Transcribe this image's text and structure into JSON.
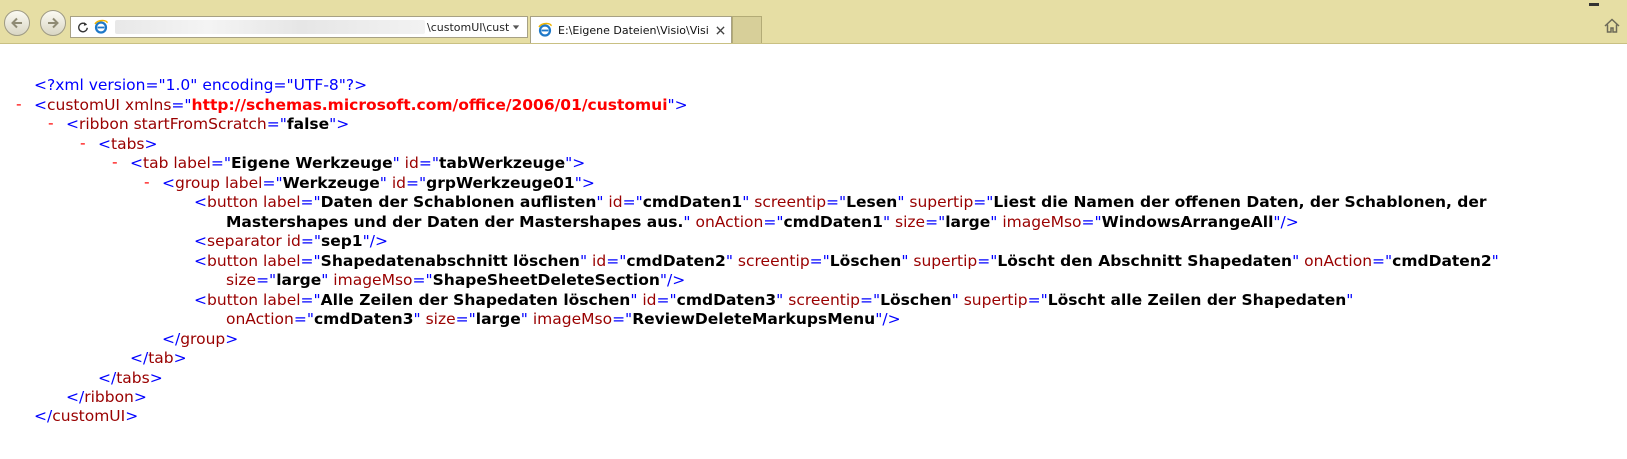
{
  "browser": {
    "address_text": "\\customUI\\custo",
    "tab_title": "E:\\Eigene Dateien\\Visio\\Visi...",
    "icons": {
      "back": "back-arrow-icon",
      "forward": "forward-arrow-icon",
      "refresh": "refresh-icon",
      "site": "ie-page-icon",
      "dropdown": "chevron-down-icon",
      "close": "close-icon",
      "home": "home-icon"
    }
  },
  "colors": {
    "chrome": "#e6dea4",
    "punctuation": "#0000ff",
    "tag": "#990000",
    "value": "#000000",
    "namespace": "#ff0000",
    "toggle": "#ff0000"
  },
  "xml": {
    "l01": {
      "open": "<?xml version=\"1.0\" encoding=\"UTF-8\"?>"
    },
    "l02": {
      "minus": "-",
      "open": "<",
      "name": "customUI",
      "a1": " xmlns",
      "eq1": "=\"",
      "ns": "http://schemas.microsoft.com/office/2006/01/customui",
      "close": "\">"
    },
    "l03": {
      "minus": "-",
      "open": "<",
      "name": "ribbon",
      "a1": " startFromScratch",
      "eq1": "=\"",
      "v1": "false",
      "close": "\">"
    },
    "l04": {
      "minus": "-",
      "open": "<",
      "name": "tabs",
      "close": ">"
    },
    "l05": {
      "minus": "-",
      "open": "<",
      "name": "tab",
      "a1": " label",
      "eq1": "=\"",
      "v1": "Eigene Werkzeuge",
      "q1": "\"",
      "a2": " id",
      "eq2": "=\"",
      "v2": "tabWerkzeuge",
      "close": "\">"
    },
    "l06": {
      "minus": "-",
      "open": "<",
      "name": "group",
      "a1": " label",
      "eq1": "=\"",
      "v1": "Werkzeuge",
      "q1": "\"",
      "a2": " id",
      "eq2": "=\"",
      "v2": "grpWerkzeuge01",
      "close": "\">"
    },
    "l07": {
      "open": "<",
      "name": "button",
      "a1": " label",
      "eq1": "=\"",
      "v1": "Daten der Schablonen auflisten",
      "q1": "\"",
      "a2": " id",
      "eq2": "=\"",
      "v2": "cmdDaten1",
      "q2": "\"",
      "a3": " screentip",
      "eq3": "=\"",
      "v3": "Lesen",
      "q3": "\"",
      "a4": " supertip",
      "eq4": "=\"",
      "v4": "Liest die Namen der offenen Daten, der Schablonen, der"
    },
    "l08": {
      "v4b": "Mastershapes und der Daten der Mastershapes aus.",
      "q4": "\"",
      "a5": " onAction",
      "eq5": "=\"",
      "v5": "cmdDaten1",
      "q5": "\"",
      "a6": " size",
      "eq6": "=\"",
      "v6": "large",
      "q6": "\"",
      "a7": " imageMso",
      "eq7": "=\"",
      "v7": "WindowsArrangeAll",
      "close": "\"/>"
    },
    "l09": {
      "open": "<",
      "name": "separator",
      "a1": " id",
      "eq1": "=\"",
      "v1": "sep1",
      "close": "\"/>"
    },
    "l10": {
      "open": "<",
      "name": "button",
      "a1": " label",
      "eq1": "=\"",
      "v1": "Shapedatenabschnitt löschen",
      "q1": "\"",
      "a2": " id",
      "eq2": "=\"",
      "v2": "cmdDaten2",
      "q2": "\"",
      "a3": " screentip",
      "eq3": "=\"",
      "v3": "Löschen",
      "q3": "\"",
      "a4": " supertip",
      "eq4": "=\"",
      "v4": "Löscht den Abschnitt Shapedaten",
      "q4": "\"",
      "a5": " onAction",
      "eq5": "=\"",
      "v5": "cmdDaten2",
      "q5": "\""
    },
    "l11": {
      "a6": "size",
      "eq6": "=\"",
      "v6": "large",
      "q6": "\"",
      "a7": " imageMso",
      "eq7": "=\"",
      "v7": "ShapeSheetDeleteSection",
      "close": "\"/>"
    },
    "l12": {
      "open": "<",
      "name": "button",
      "a1": " label",
      "eq1": "=\"",
      "v1": "Alle Zeilen der Shapedaten löschen",
      "q1": "\"",
      "a2": " id",
      "eq2": "=\"",
      "v2": "cmdDaten3",
      "q2": "\"",
      "a3": " screentip",
      "eq3": "=\"",
      "v3": "Löschen",
      "q3": "\"",
      "a4": " supertip",
      "eq4": "=\"",
      "v4": "Löscht alle Zeilen der Shapedaten",
      "q4": "\""
    },
    "l13": {
      "a5": "onAction",
      "eq5": "=\"",
      "v5": "cmdDaten3",
      "q5": "\"",
      "a6": " size",
      "eq6": "=\"",
      "v6": "large",
      "q6": "\"",
      "a7": " imageMso",
      "eq7": "=\"",
      "v7": "ReviewDeleteMarkupsMenu",
      "close": "\"/>"
    },
    "l14": {
      "open": "</",
      "name": "group",
      "close": ">"
    },
    "l15": {
      "open": "</",
      "name": "tab",
      "close": ">"
    },
    "l16": {
      "open": "</",
      "name": "tabs",
      "close": ">"
    },
    "l17": {
      "open": "</",
      "name": "ribbon",
      "close": ">"
    },
    "l18": {
      "open": "</",
      "name": "customUI",
      "close": ">"
    }
  }
}
